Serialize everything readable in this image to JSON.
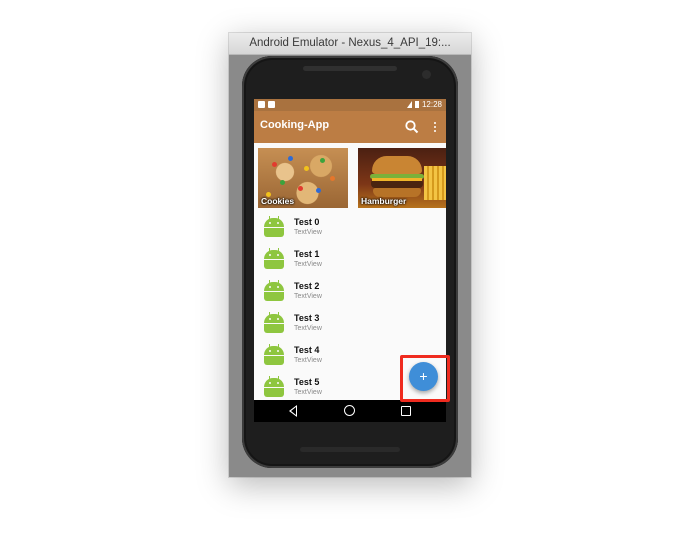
{
  "emulator": {
    "title": "Android Emulator - Nexus_4_API_19:..."
  },
  "statusbar": {
    "time": "12:28"
  },
  "appbar": {
    "title": "Cooking-App",
    "search_icon": "search-icon",
    "more_icon": "more-vertical-icon"
  },
  "categories": [
    {
      "label": "Cookies"
    },
    {
      "label": "Hamburger"
    }
  ],
  "list": [
    {
      "title": "Test 0",
      "subtitle": "TextView"
    },
    {
      "title": "Test 1",
      "subtitle": "TextView"
    },
    {
      "title": "Test 2",
      "subtitle": "TextView"
    },
    {
      "title": "Test 3",
      "subtitle": "TextView"
    },
    {
      "title": "Test 4",
      "subtitle": "TextView"
    },
    {
      "title": "Test 5",
      "subtitle": "TextView"
    }
  ],
  "fab": {
    "label": "+"
  },
  "colors": {
    "statusbar": "#a9723f",
    "appbar": "#bc7d44",
    "fab": "#3f8ed8",
    "highlight": "#ef2b1f",
    "android_green": "#8ec63f"
  }
}
